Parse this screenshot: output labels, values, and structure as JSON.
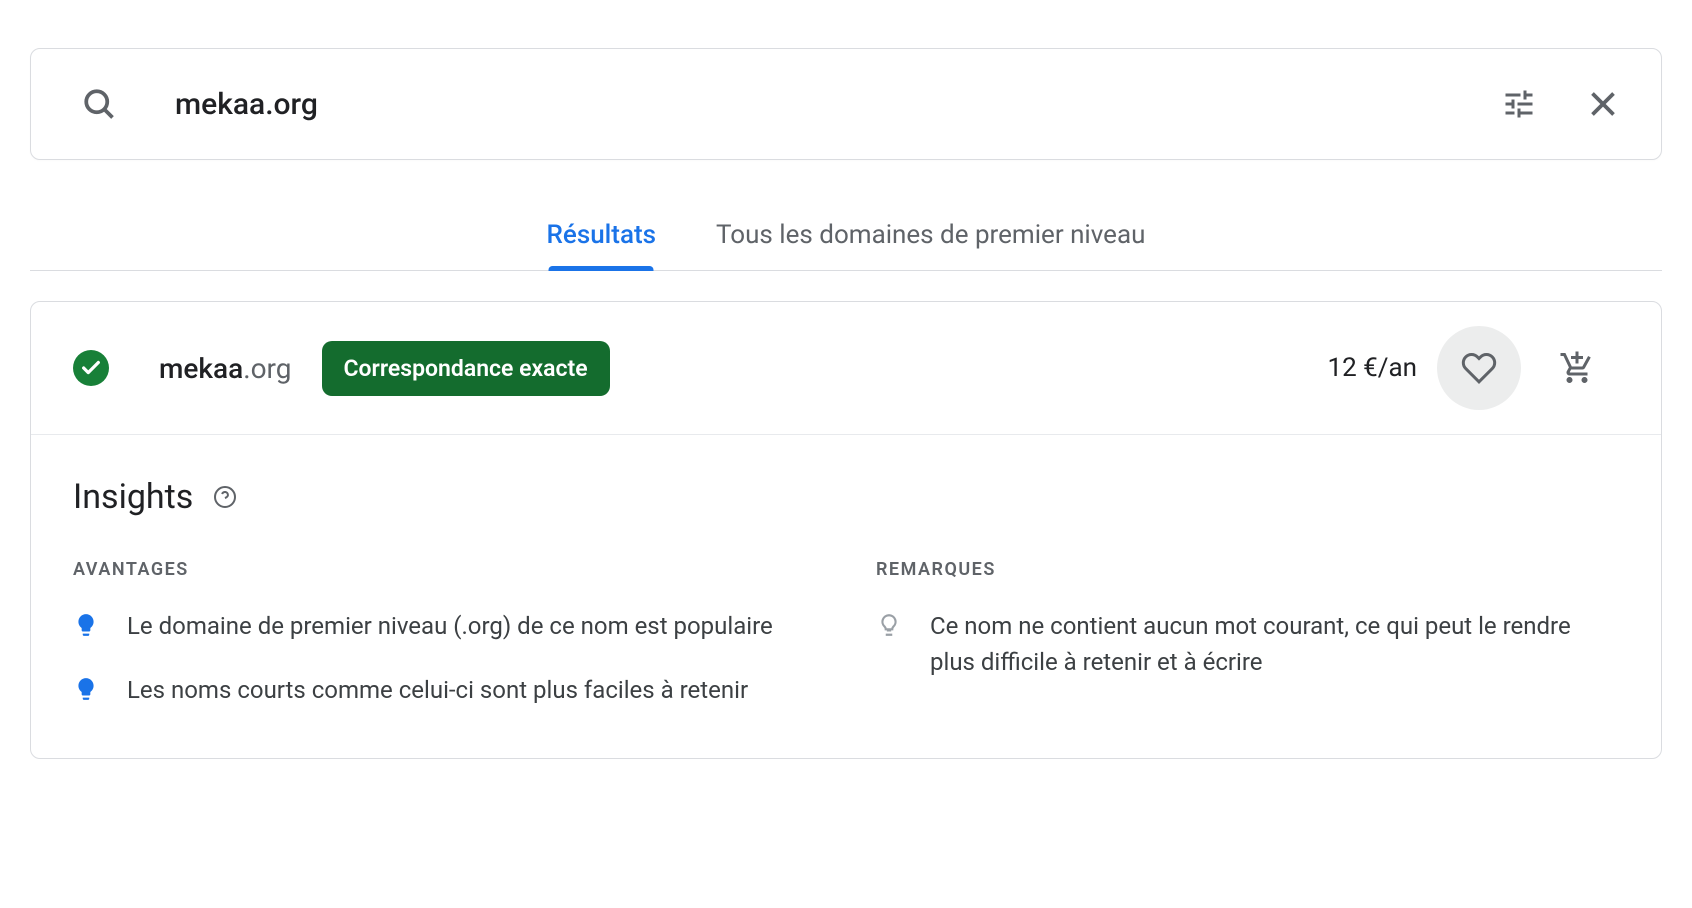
{
  "search": {
    "value": "mekaa.org"
  },
  "tabs": {
    "results": "Résultats",
    "all_tlds": "Tous les domaines de premier niveau"
  },
  "result": {
    "domain_sld": "mekaa",
    "domain_tld": ".org",
    "badge": "Correspondance exacte",
    "price": "12 €/an"
  },
  "insights": {
    "title": "Insights",
    "advantages_heading": "AVANTAGES",
    "remarks_heading": "REMARQUES",
    "advantages": [
      "Le domaine de premier niveau (.org) de ce nom est populaire",
      "Les noms courts comme celui-ci sont plus faciles à retenir"
    ],
    "remarks": [
      "Ce nom ne contient aucun mot courant, ce qui peut le rendre plus difficile à retenir et à écrire"
    ]
  }
}
